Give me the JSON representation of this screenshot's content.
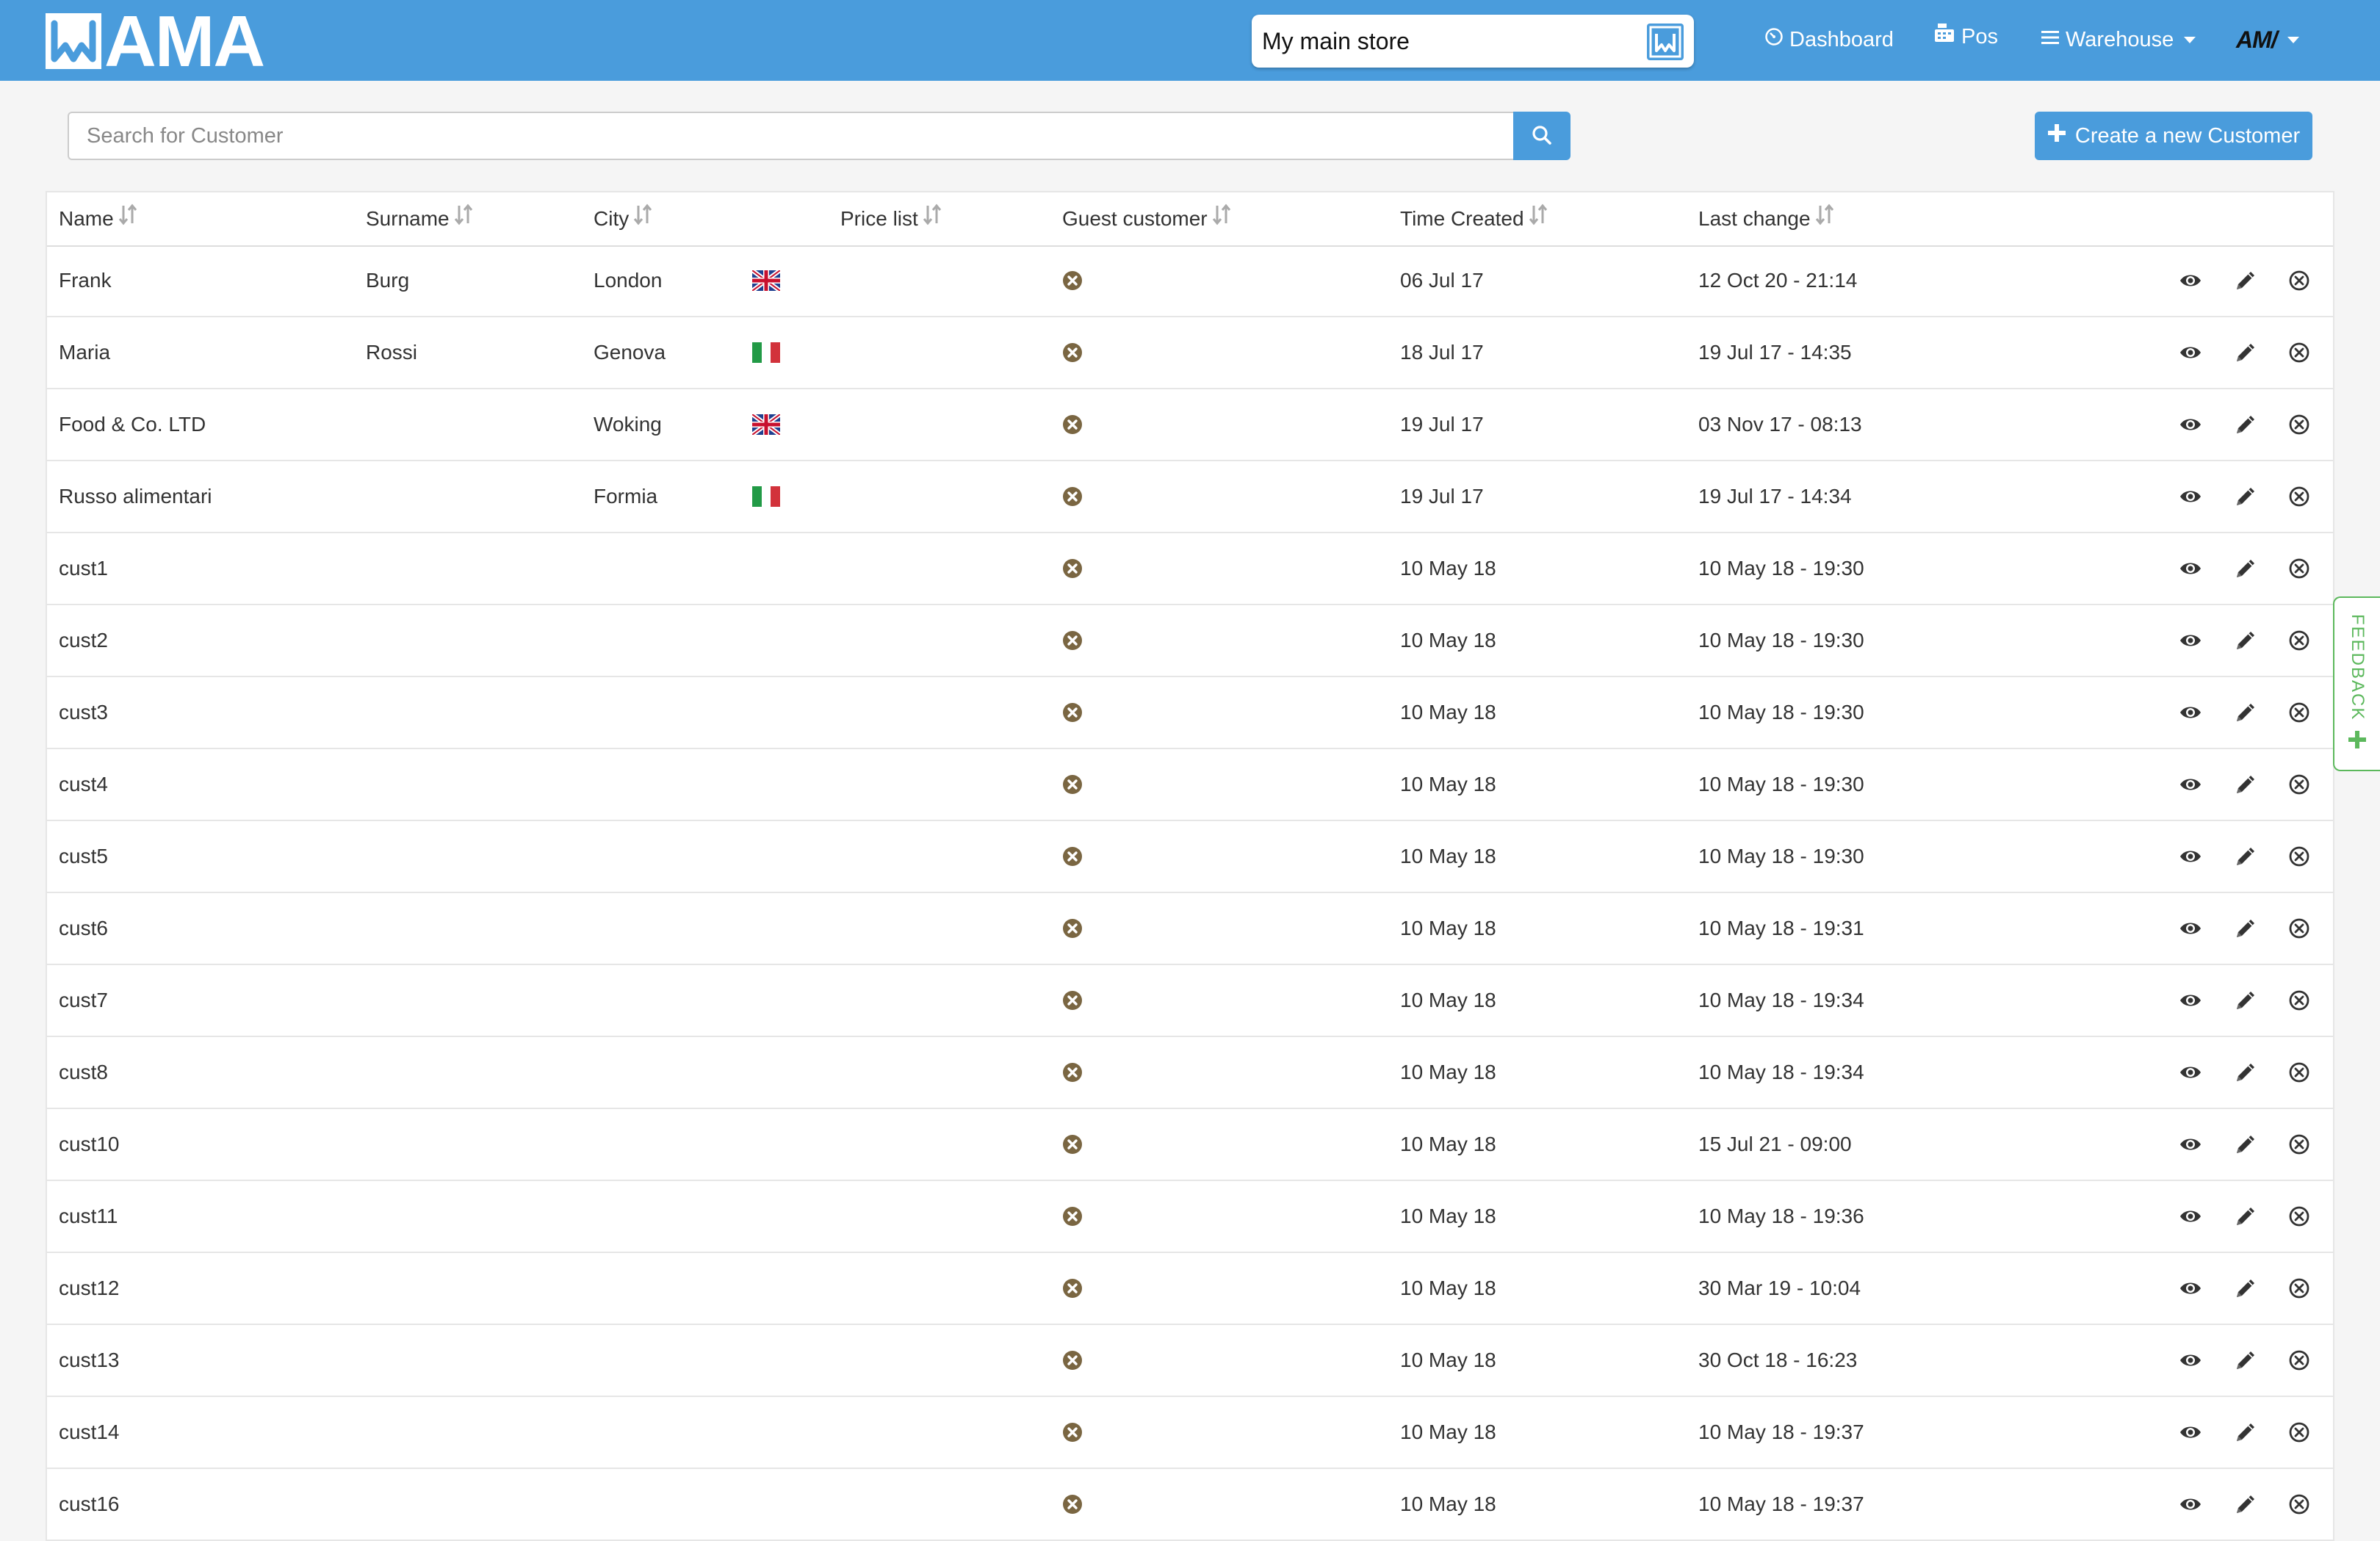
{
  "header": {
    "logo_text": "AMA",
    "store_name": "My main store",
    "nav": {
      "dashboard": "Dashboard",
      "pos": "Pos",
      "warehouse": "Warehouse",
      "user_label": "AM/"
    }
  },
  "search": {
    "placeholder": "Search for Customer",
    "value": ""
  },
  "actions": {
    "create_label": "Create a new Customer"
  },
  "table": {
    "columns": [
      "Name",
      "Surname",
      "City",
      "Price list",
      "Guest customer",
      "Time Created",
      "Last change"
    ],
    "rows": [
      {
        "name": "Frank",
        "surname": "Burg",
        "city": "London",
        "flag": "uk-flag-icon",
        "price_list": "",
        "created": "06 Jul 17",
        "changed": "12 Oct 20 - 21:14"
      },
      {
        "name": "Maria",
        "surname": "Rossi",
        "city": "Genova",
        "flag": "italy-flag-icon",
        "price_list": "",
        "created": "18 Jul 17",
        "changed": "19 Jul 17 - 14:35"
      },
      {
        "name": "Food & Co. LTD",
        "surname": "",
        "city": "Woking",
        "flag": "uk-flag-icon",
        "price_list": "",
        "created": "19 Jul 17",
        "changed": "03 Nov 17 - 08:13"
      },
      {
        "name": "Russo alimentari",
        "surname": "",
        "city": "Formia",
        "flag": "italy-flag-icon",
        "price_list": "",
        "created": "19 Jul 17",
        "changed": "19 Jul 17 - 14:34"
      },
      {
        "name": "cust1",
        "surname": "",
        "city": "",
        "flag": "",
        "price_list": "",
        "created": "10 May 18",
        "changed": "10 May 18 - 19:30"
      },
      {
        "name": "cust2",
        "surname": "",
        "city": "",
        "flag": "",
        "price_list": "",
        "created": "10 May 18",
        "changed": "10 May 18 - 19:30"
      },
      {
        "name": "cust3",
        "surname": "",
        "city": "",
        "flag": "",
        "price_list": "",
        "created": "10 May 18",
        "changed": "10 May 18 - 19:30"
      },
      {
        "name": "cust4",
        "surname": "",
        "city": "",
        "flag": "",
        "price_list": "",
        "created": "10 May 18",
        "changed": "10 May 18 - 19:30"
      },
      {
        "name": "cust5",
        "surname": "",
        "city": "",
        "flag": "",
        "price_list": "",
        "created": "10 May 18",
        "changed": "10 May 18 - 19:30"
      },
      {
        "name": "cust6",
        "surname": "",
        "city": "",
        "flag": "",
        "price_list": "",
        "created": "10 May 18",
        "changed": "10 May 18 - 19:31"
      },
      {
        "name": "cust7",
        "surname": "",
        "city": "",
        "flag": "",
        "price_list": "",
        "created": "10 May 18",
        "changed": "10 May 18 - 19:34"
      },
      {
        "name": "cust8",
        "surname": "",
        "city": "",
        "flag": "",
        "price_list": "",
        "created": "10 May 18",
        "changed": "10 May 18 - 19:34"
      },
      {
        "name": "cust10",
        "surname": "",
        "city": "",
        "flag": "",
        "price_list": "",
        "created": "10 May 18",
        "changed": "15 Jul 21 - 09:00"
      },
      {
        "name": "cust11",
        "surname": "",
        "city": "",
        "flag": "",
        "price_list": "",
        "created": "10 May 18",
        "changed": "10 May 18 - 19:36"
      },
      {
        "name": "cust12",
        "surname": "",
        "city": "",
        "flag": "",
        "price_list": "",
        "created": "10 May 18",
        "changed": "30 Mar 19 - 10:04"
      },
      {
        "name": "cust13",
        "surname": "",
        "city": "",
        "flag": "",
        "price_list": "",
        "created": "10 May 18",
        "changed": "30 Oct 18 - 16:23"
      },
      {
        "name": "cust14",
        "surname": "",
        "city": "",
        "flag": "",
        "price_list": "",
        "created": "10 May 18",
        "changed": "10 May 18 - 19:37"
      },
      {
        "name": "cust16",
        "surname": "",
        "city": "",
        "flag": "",
        "price_list": "",
        "created": "10 May 18",
        "changed": "10 May 18 - 19:37"
      }
    ]
  },
  "feedback": {
    "label": "FEEDBACK"
  },
  "colors": {
    "brand": "#4a9cdc",
    "guest_icon": "#7a6642",
    "feedback": "#5cb85c"
  }
}
